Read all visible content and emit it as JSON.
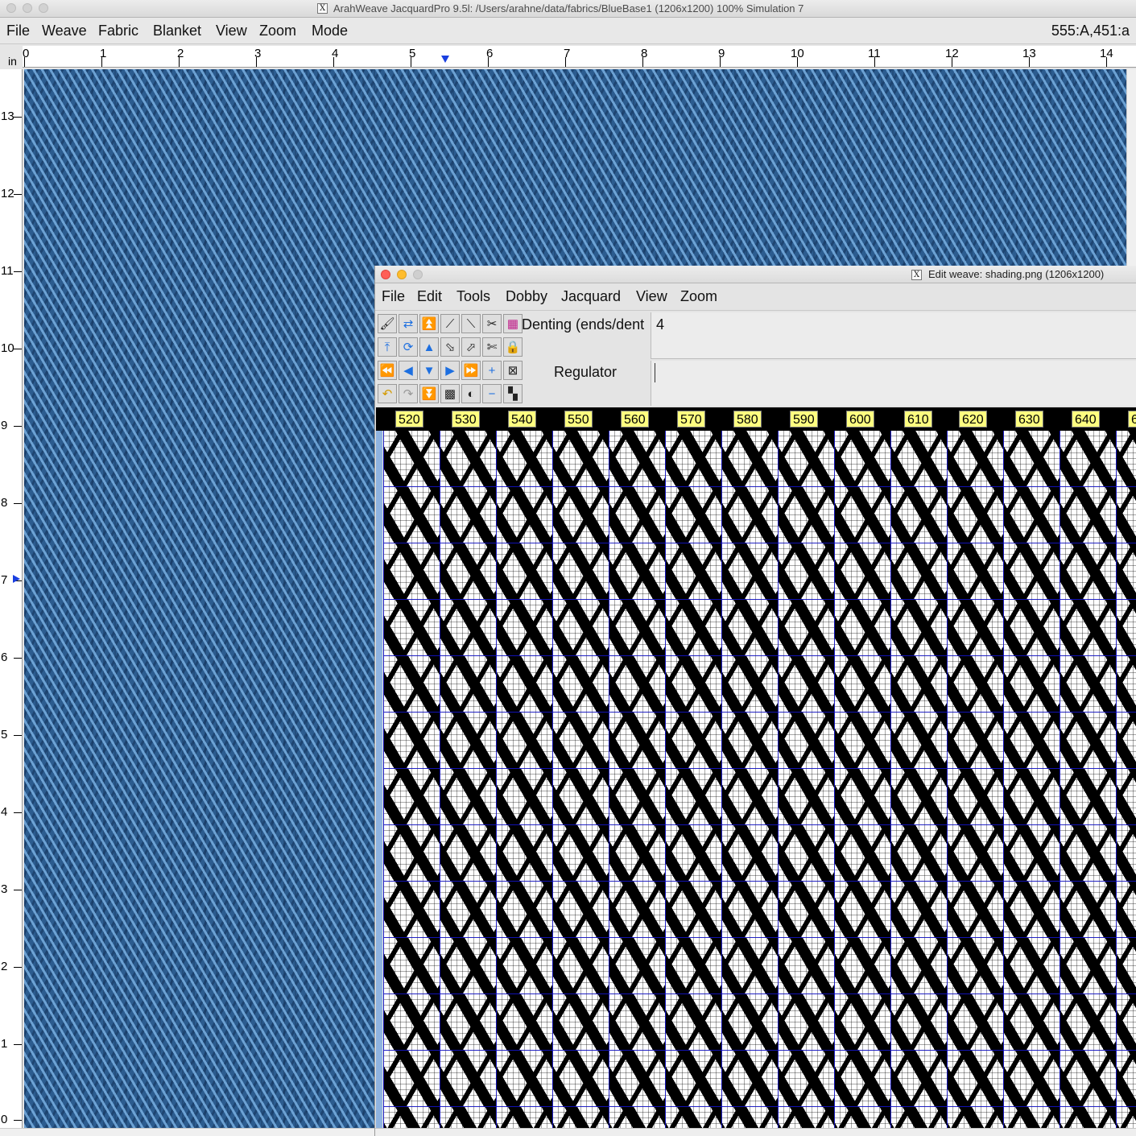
{
  "main_window": {
    "title": "ArahWeave JacquardPro 9.5l: /Users/arahne/data/fabrics/BlueBase1 (1206x1200) 100% Simulation 7",
    "menu": [
      "File",
      "Weave",
      "Fabric",
      "Blanket",
      "View",
      "Zoom",
      "Mode"
    ],
    "cursor_coord": "555:A,451:a",
    "ruler_unit": "in",
    "h_ruler": [
      "0",
      "1",
      "2",
      "3",
      "4",
      "5",
      "6",
      "7",
      "8",
      "9",
      "10",
      "11",
      "12",
      "13",
      "14"
    ],
    "v_ruler": [
      "13",
      "12",
      "11",
      "10",
      "9",
      "8",
      "7",
      "6",
      "5",
      "4",
      "3",
      "2",
      "1",
      "0"
    ]
  },
  "edit_window": {
    "title": "Edit weave: shading.png (1206x1200)",
    "menu": [
      "File",
      "Edit",
      "Tools",
      "Dobby",
      "Jacquard",
      "View",
      "Zoom"
    ],
    "denting_label": "Denting (ends/dent",
    "denting_value": "4",
    "regulator_label": "Regulator",
    "regulator_value": "",
    "column_numbers": [
      "520",
      "530",
      "540",
      "550",
      "560",
      "570",
      "580",
      "590",
      "600",
      "610",
      "620",
      "630",
      "640",
      "6"
    ],
    "toolbar_icons": [
      "brush-icon",
      "swap-icon",
      "shift-up-icon",
      "twill-right-icon",
      "twill-left-icon",
      "scissors-icon",
      "grid-color-icon",
      "insert-icon",
      "rotate-icon",
      "move-up-icon",
      "stair-down-icon",
      "stair-up-icon",
      "cut-icon",
      "lock-icon",
      "rewind-icon",
      "left-icon",
      "down-icon",
      "right-icon",
      "forward-icon",
      "plus-icon",
      "clear-icon",
      "undo-icon",
      "redo-icon",
      "double-down-icon",
      "pattern-icon",
      "invert-icon",
      "minus-icon",
      "checker-icon"
    ]
  },
  "colors": {
    "fabric_base": "#2c5c8f",
    "column_label_bg": "#ffff80",
    "grid_line": "#1414c8"
  }
}
